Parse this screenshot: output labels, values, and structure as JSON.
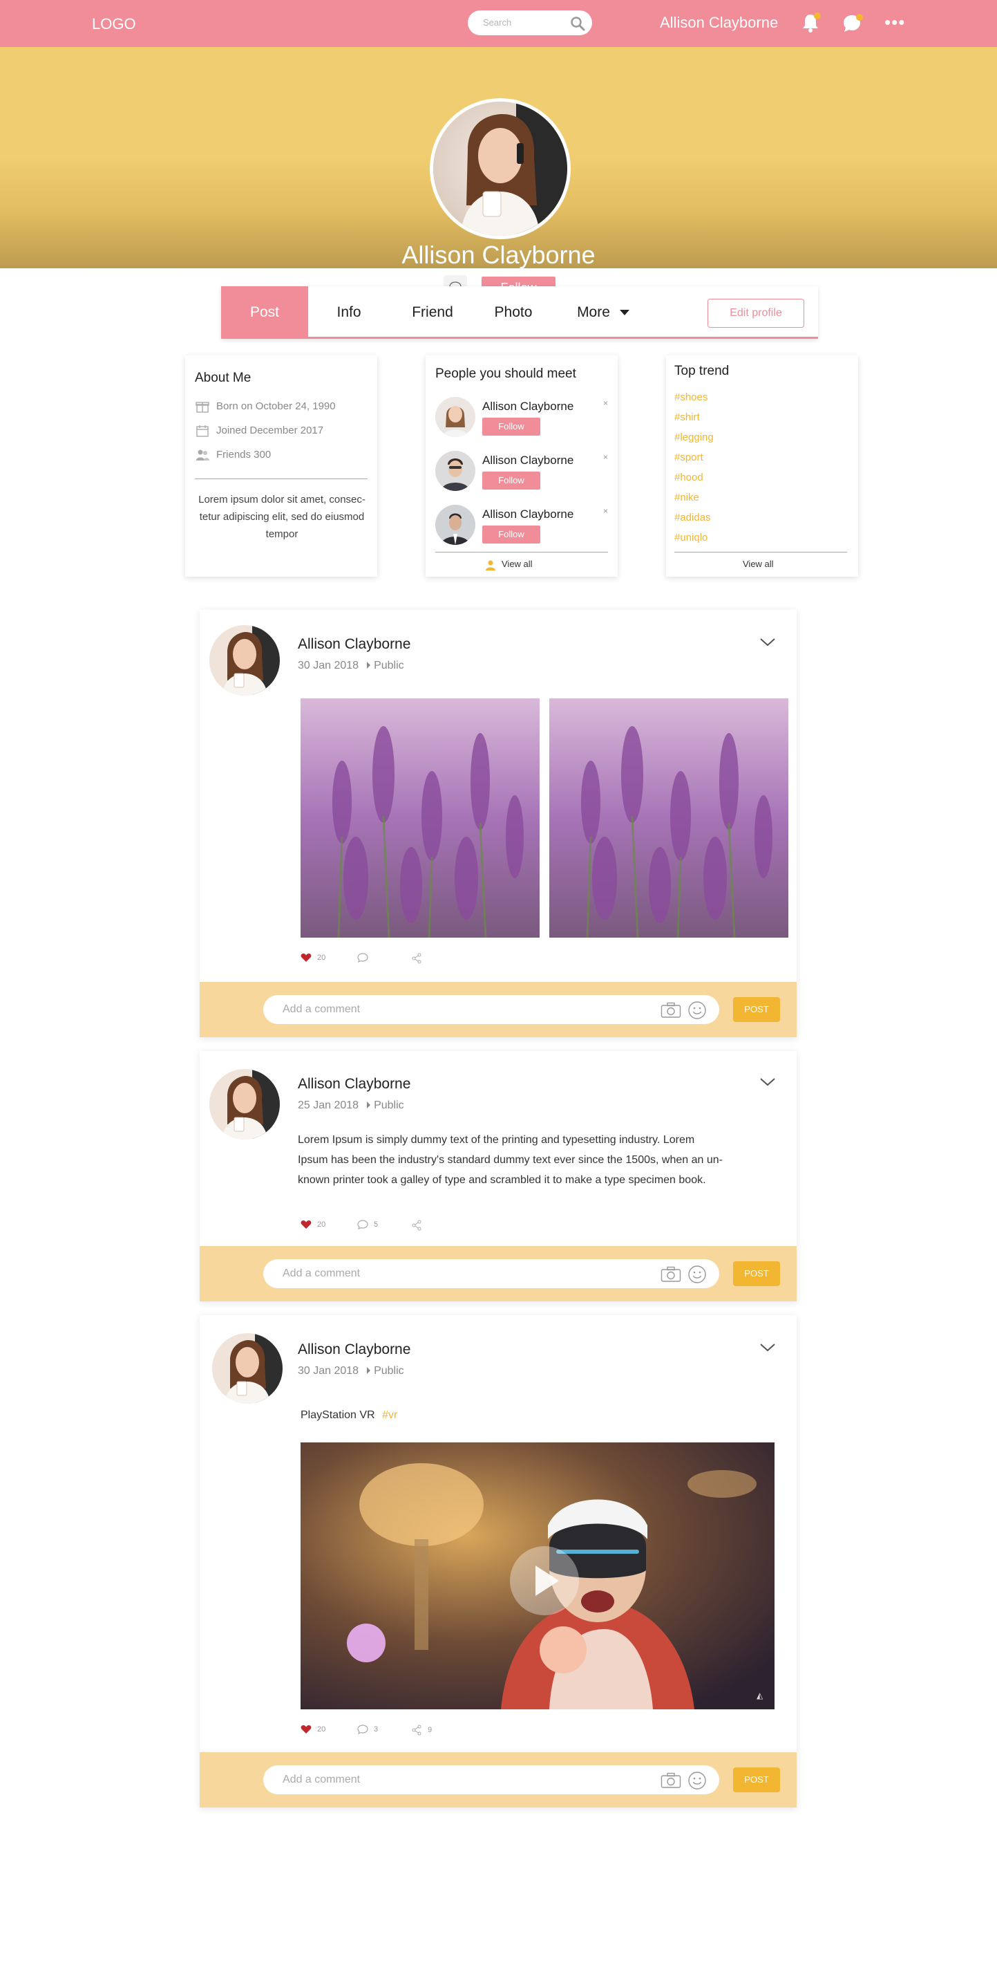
{
  "header": {
    "logo": "LOGO",
    "search_placeholder": "Search",
    "user_name": "Allison Clayborne",
    "more": "•••"
  },
  "profile": {
    "name": "Allison Clayborne",
    "follow_label": "Follow"
  },
  "tabs": [
    {
      "label": "Post",
      "active": true
    },
    {
      "label": "Info"
    },
    {
      "label": "Friend"
    },
    {
      "label": "Photo"
    },
    {
      "label": "More"
    }
  ],
  "edit_profile_label": "Edit profile",
  "about": {
    "title": "About Me",
    "born": "Born on October 24, 1990",
    "joined": "Joined December 2017",
    "friends": "Friends 300",
    "bio": "Lorem ipsum dolor sit amet, consec-tetur adipiscing elit, sed do eiusmod tempor"
  },
  "people": {
    "title": "People you should meet",
    "items": [
      {
        "name": "Allison Clayborne",
        "follow": "Follow",
        "close": "×"
      },
      {
        "name": "Allison Clayborne",
        "follow": "Follow",
        "close": "×"
      },
      {
        "name": "Allison Clayborne",
        "follow": "Follow",
        "close": "×"
      }
    ],
    "view_all": "View all"
  },
  "trends": {
    "title": "Top trend",
    "tags": [
      "#shoes",
      "#shirt",
      "#legging",
      "#sport",
      "#hood",
      "#nike",
      "#adidas",
      "#uniqlo"
    ],
    "view_all": "View all"
  },
  "posts": [
    {
      "author": "Allison Clayborne",
      "date": "30 Jan 2018",
      "visibility": "Public",
      "likes": "20",
      "comments": "",
      "shares": "",
      "comment_placeholder": "Add a comment",
      "post_label": "POST"
    },
    {
      "author": "Allison Clayborne",
      "date": "25 Jan 2018",
      "visibility": "Public",
      "text_lines": [
        "Lorem Ipsum is simply dummy text of the printing and typesetting industry. Lorem",
        "Ipsum has been the industry's standard dummy text ever since the 1500s, when an un-",
        "known printer took a galley of type and scrambled it to make a type specimen book."
      ],
      "likes": "20",
      "comments": "5",
      "shares": "",
      "comment_placeholder": "Add a comment",
      "post_label": "POST"
    },
    {
      "author": "Allison Clayborne",
      "date": "30 Jan 2018",
      "visibility": "Public",
      "caption": "PlayStation VR",
      "hashtag": "#vr",
      "likes": "20",
      "comments": "3",
      "shares": "9",
      "comment_placeholder": "Add a comment",
      "post_label": "POST"
    }
  ],
  "colors": {
    "pink": "#f18d98",
    "yellow": "#f0cd70",
    "gold": "#f2b633",
    "comment_bar": "#f7d79c"
  }
}
